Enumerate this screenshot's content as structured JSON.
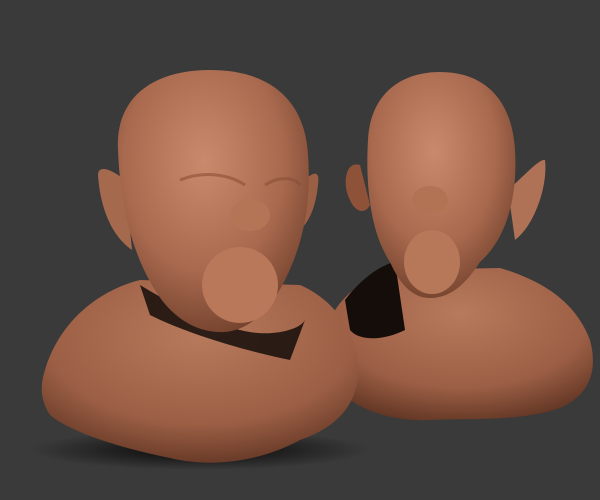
{
  "scene": {
    "background": "#3a3a3a",
    "clay_light": "#c98a6c",
    "clay_mid": "#a8694e",
    "clay_dark": "#6e3e2a",
    "shadow": "#120c0a",
    "models": [
      "left-bust",
      "right-bust"
    ]
  }
}
